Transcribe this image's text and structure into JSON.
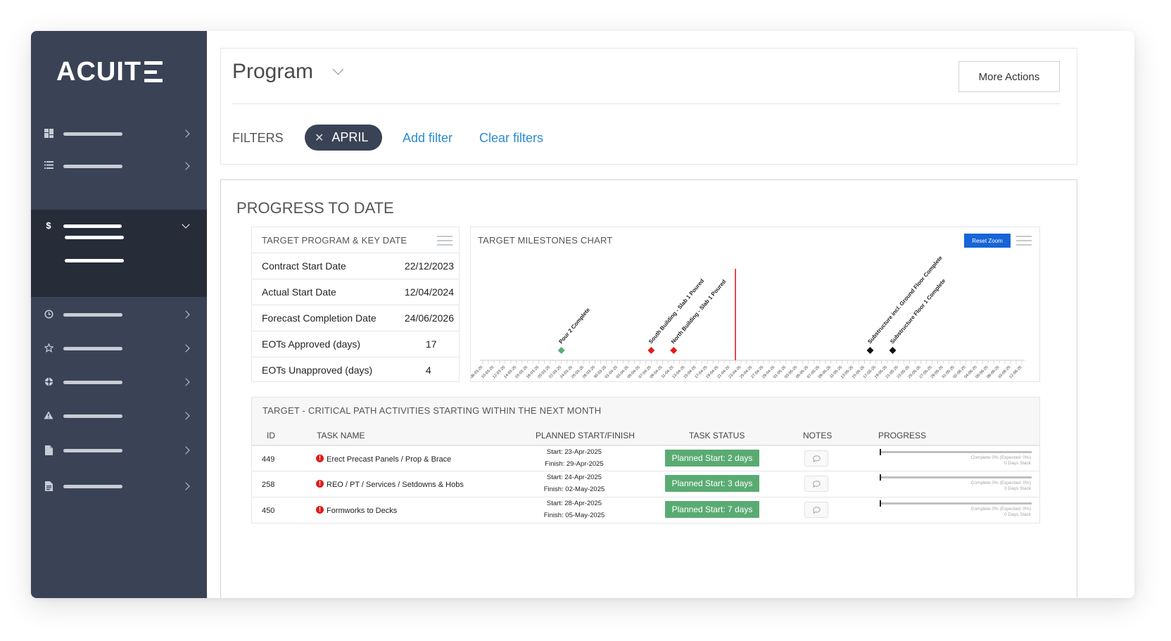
{
  "app": {
    "logo_text": "ACUIT"
  },
  "sidebar": {
    "items": [
      {
        "icon": "dashboard-grid-icon"
      },
      {
        "icon": "list-icon"
      },
      {
        "icon": "dollar-icon",
        "symbol": "$",
        "active": true,
        "subitems": 2
      },
      {
        "icon": "clock-icon"
      },
      {
        "icon": "star-icon"
      },
      {
        "icon": "gear-wheel-icon"
      },
      {
        "icon": "warning-icon"
      },
      {
        "icon": "file-icon"
      },
      {
        "icon": "document-icon"
      }
    ]
  },
  "header": {
    "title": "Program",
    "more_actions": "More Actions",
    "filters_label": "FILTERS",
    "active_filter": "APRIL",
    "add_filter": "Add filter",
    "clear_filters": "Clear filters"
  },
  "progress": {
    "title": "PROGRESS TO DATE",
    "key_dates": {
      "header": "TARGET PROGRAM & KEY DATE",
      "rows": [
        {
          "label": "Contract Start Date",
          "value": "22/12/2023"
        },
        {
          "label": "Actual Start Date",
          "value": "12/04/2024"
        },
        {
          "label": "Forecast Completion Date",
          "value": "24/06/2026"
        },
        {
          "label": "EOTs Approved (days)",
          "value": "17"
        },
        {
          "label": "EOTs Unapproved (days)",
          "value": "4"
        }
      ]
    },
    "milestones": {
      "header": "TARGET MILESTONES CHART",
      "reset_zoom": "Reset Zoom"
    },
    "critical_path": {
      "header": "TARGET - CRITICAL PATH ACTIVITIES STARTING WITHIN THE NEXT MONTH",
      "columns": [
        "ID",
        "TASK NAME",
        "PLANNED START/FINISH",
        "TASK STATUS",
        "NOTES",
        "PROGRESS"
      ],
      "rows": [
        {
          "id": "449",
          "task": "Erect Precast Panels /  Prop & Brace",
          "start": "Start: 23-Apr-2025",
          "finish": "Finish: 29-Apr-2025",
          "status": "Planned Start: 2 days",
          "progress": 0,
          "progress_text": "Complete 0% (Expected: 0%)",
          "slack_text": "0 Days Slack"
        },
        {
          "id": "258",
          "task": "REO / PT / Services / Setdowns & Hobs",
          "start": "Start: 24-Apr-2025",
          "finish": "Finish: 02-May-2025",
          "status": "Planned Start: 3 days",
          "progress": 0,
          "progress_text": "Complete 0% (Expected: 0%)",
          "slack_text": "0 Days Slack"
        },
        {
          "id": "450",
          "task": "Formworks to Decks",
          "start": "Start: 28-Apr-2025",
          "finish": "Finish: 05-May-2025",
          "status": "Planned Start: 7 days",
          "progress": 0,
          "progress_text": "Complete 0% (Expected: 0%)",
          "slack_text": "0 Days Slack"
        }
      ]
    }
  },
  "chart_data": {
    "type": "scatter",
    "title": "TARGET MILESTONES CHART",
    "x_tick_labels": [
      "08-03-25",
      "10-03-25",
      "12-03-25",
      "14-03-25",
      "16-03-25",
      "18-03-25",
      "20-03-25",
      "22-03-25",
      "24-03-25",
      "26-03-25",
      "28-03-25",
      "30-03-25",
      "01-04-25",
      "03-04-25",
      "05-04-25",
      "07-04-25",
      "09-04-25",
      "11-04-25",
      "13-04-25",
      "15-04-25",
      "17-04-25",
      "19-04-25",
      "21-04-25",
      "23-04-25",
      "25-04-25",
      "27-04-25",
      "29-04-25",
      "01-05-25",
      "03-05-25",
      "05-05-25",
      "07-05-25",
      "09-05-25",
      "11-05-25",
      "13-05-25",
      "15-05-25",
      "17-05-25",
      "19-05-25",
      "21-05-25",
      "23-05-25",
      "25-05-25",
      "27-05-25",
      "29-05-25",
      "31-05-25",
      "02-06-25",
      "04-06-25",
      "06-06-25",
      "08-06-25",
      "10-06-25",
      "12-06-25"
    ],
    "today_marker": "22-04-25",
    "milestones": [
      {
        "date": "22-03-25",
        "name": "Pour 2 Complete",
        "color": "#5aab73"
      },
      {
        "date": "07-04-25",
        "name": "South Building - Slab 1 Poured",
        "color": "#e21b1b"
      },
      {
        "date": "11-04-25",
        "name": "North Building - Slab 1 Poured",
        "color": "#e21b1b"
      },
      {
        "date": "16-05-25",
        "name": "Substructure incl. Ground Floor Complete",
        "color": "#111111"
      },
      {
        "date": "20-05-25",
        "name": "Substructure Floor 1 Complete",
        "color": "#111111"
      }
    ]
  }
}
